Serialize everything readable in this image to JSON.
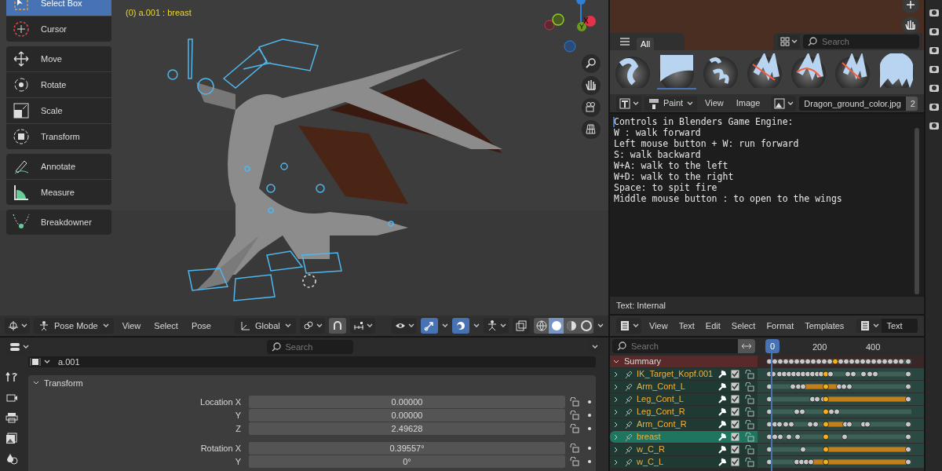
{
  "viewport": {
    "info": "(0) a.001 : breast",
    "tool_groups": [
      {
        "tools": [
          {
            "label": "Select Box",
            "kind": "select",
            "selected": true
          },
          {
            "label": "Cursor",
            "kind": "cursor",
            "selected": false
          }
        ]
      },
      {
        "tools": [
          {
            "label": "Move",
            "kind": "move",
            "selected": false
          },
          {
            "label": "Rotate",
            "kind": "rotate",
            "selected": false
          },
          {
            "label": "Scale",
            "kind": "scale",
            "selected": false
          },
          {
            "label": "Transform",
            "kind": "transform",
            "selected": false
          }
        ]
      },
      {
        "tools": [
          {
            "label": "Annotate",
            "kind": "annotate",
            "selected": false
          },
          {
            "label": "Measure",
            "kind": "measure",
            "selected": false
          }
        ]
      },
      {
        "tools": [
          {
            "label": "Breakdowner",
            "kind": "breakdowner",
            "selected": false
          }
        ]
      }
    ],
    "gizmo": {
      "x": "X",
      "y": "Y"
    },
    "header": {
      "mode": "Pose Mode",
      "menus": [
        "View",
        "Select",
        "Pose"
      ],
      "orientation": "Global"
    }
  },
  "asset_shelf": {
    "tab": "All",
    "search_placeholder": "Search",
    "brushes": [
      {
        "selected": false
      },
      {
        "selected": true
      },
      {
        "selected": false
      },
      {
        "selected": false
      },
      {
        "selected": false
      },
      {
        "selected": false
      },
      {
        "selected": false
      }
    ]
  },
  "image_header": {
    "mode": "Paint",
    "menus": [
      "View",
      "Image"
    ],
    "image_name": "Dragon_ground_color.jpg",
    "users": "2"
  },
  "text_editor": {
    "lines": [
      "Controls in Blenders Game Engine:",
      "W : walk forward",
      "Left mouse button + W: run forward",
      "S: walk backward",
      "W+A: walk to the left",
      "W+D: walk to the right",
      "Space: to spit fire",
      "Middle mouse button : to open to the wings"
    ],
    "footer": "Text: Internal",
    "menus": [
      "View",
      "Text",
      "Edit",
      "Select",
      "Format",
      "Templates"
    ],
    "datablock": "Text"
  },
  "properties": {
    "search_placeholder": "Search",
    "object_name": "a.001",
    "panel": {
      "title": "Transform",
      "expanded": true
    },
    "rows": [
      {
        "label": "Location X",
        "value": "0.00000",
        "group_start": true
      },
      {
        "label": "Y",
        "value": "0.00000",
        "group_start": false
      },
      {
        "label": "Z",
        "value": "2.49628",
        "group_start": false
      },
      {
        "label": "Rotation X",
        "value": "0.39557°",
        "group_start": true
      },
      {
        "label": "Y",
        "value": "0°",
        "group_start": false
      }
    ]
  },
  "dopesheet": {
    "search_placeholder": "Search",
    "current_frame": "0",
    "frame_labels": [
      "200",
      "400"
    ],
    "summary": "Summary",
    "channels": [
      {
        "name": "IK_Target_Kopf.001",
        "selected": false
      },
      {
        "name": "Arm_Cont_L",
        "selected": false
      },
      {
        "name": "Leg_Cont_L",
        "selected": false
      },
      {
        "name": "Leg_Cont_R",
        "selected": false
      },
      {
        "name": "Arm_Cont_R",
        "selected": false
      },
      {
        "name": "breast",
        "selected": true
      },
      {
        "name": "w_C_R",
        "selected": false
      },
      {
        "name": "w_C_L",
        "selected": false
      }
    ]
  }
}
